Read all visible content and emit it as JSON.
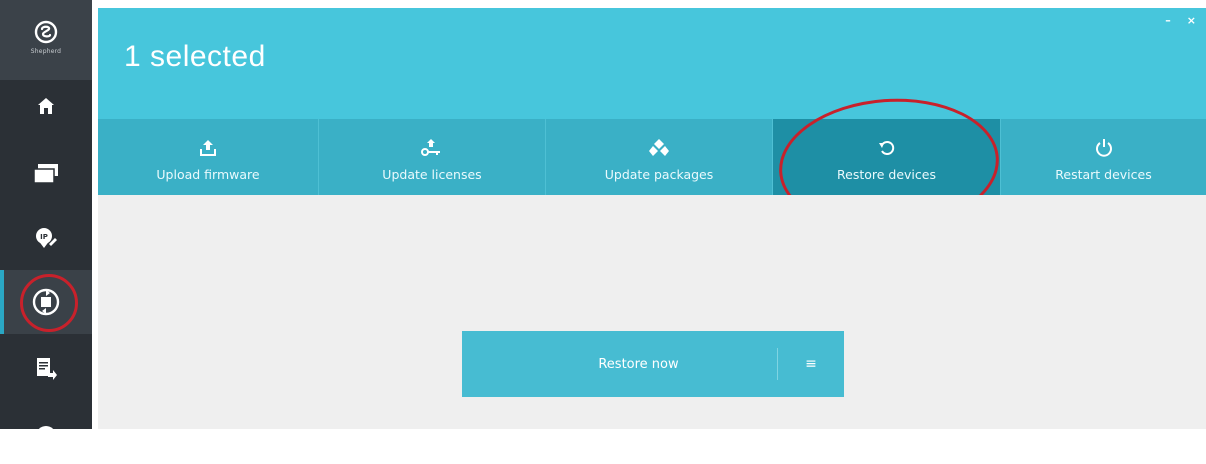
{
  "sidebar": {
    "logo_text": "Shepherd",
    "items": [
      {
        "icon": "home-icon"
      },
      {
        "icon": "devices-icon"
      },
      {
        "icon": "ip-location-icon"
      },
      {
        "icon": "sync-maintenance-icon",
        "active": true
      },
      {
        "icon": "export-log-icon"
      },
      {
        "icon": "info-icon"
      }
    ]
  },
  "header": {
    "title": "1 selected",
    "minimize": "–",
    "close": "×"
  },
  "toolbar": {
    "actions": [
      {
        "label": "Upload firmware",
        "icon": "upload-icon"
      },
      {
        "label": "Update licenses",
        "icon": "license-key-icon"
      },
      {
        "label": "Update packages",
        "icon": "packages-icon"
      },
      {
        "label": "Restore devices",
        "icon": "restore-icon",
        "active": true
      },
      {
        "label": "Restart devices",
        "icon": "power-icon"
      }
    ]
  },
  "main": {
    "restore_button_label": "Restore now",
    "menu_glyph": "≡"
  },
  "colors": {
    "header": "#47c6dc",
    "toolbar": "#3ab0c6",
    "toolbar_active": "#1e8fa5",
    "sidebar": "#2b3036",
    "annotation": "#c8212b"
  }
}
